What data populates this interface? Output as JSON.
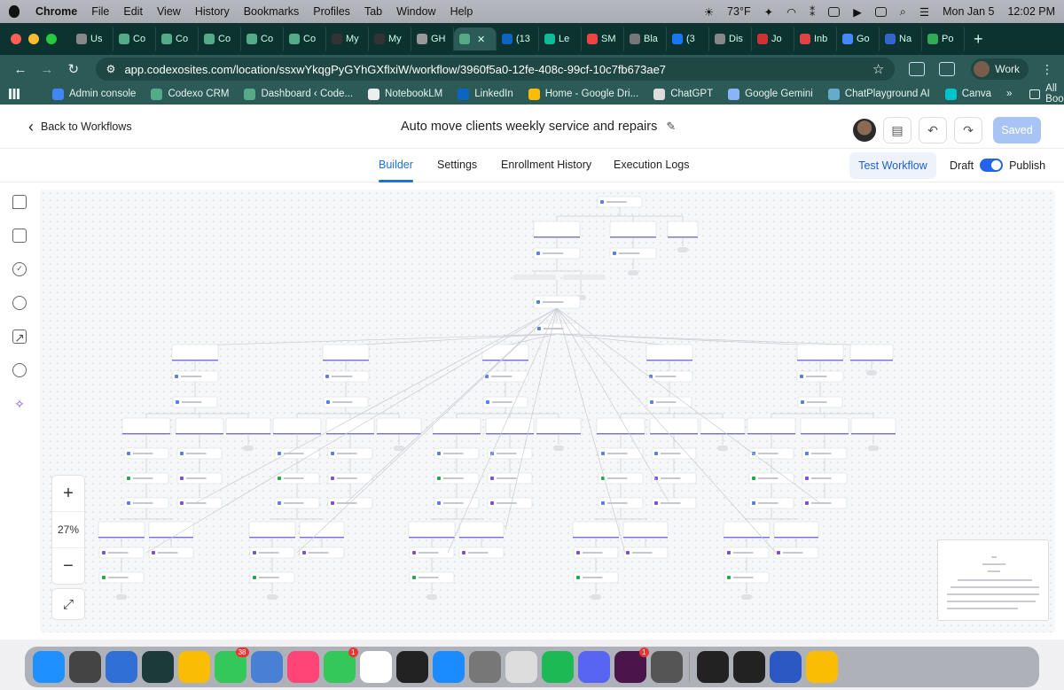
{
  "menubar": {
    "app": "Chrome",
    "items": [
      "File",
      "Edit",
      "View",
      "History",
      "Bookmarks",
      "Profiles",
      "Tab",
      "Window",
      "Help"
    ],
    "weather": "73°F",
    "date": "Mon Jan 5",
    "time": "12:02 PM"
  },
  "tabs": [
    {
      "label": "Us",
      "color": "#888"
    },
    {
      "label": "Co",
      "color": "#5a8"
    },
    {
      "label": "Co",
      "color": "#5a8"
    },
    {
      "label": "Co",
      "color": "#5a8"
    },
    {
      "label": "Co",
      "color": "#5a8"
    },
    {
      "label": "Co",
      "color": "#5a8"
    },
    {
      "label": "My",
      "color": "#333"
    },
    {
      "label": "My",
      "color": "#333"
    },
    {
      "label": "GH",
      "color": "#999"
    },
    {
      "label": "",
      "color": "#5a8",
      "active": true
    },
    {
      "label": "(13",
      "color": "#0a66c2"
    },
    {
      "label": "Le",
      "color": "#1b9"
    },
    {
      "label": "SM",
      "color": "#e44"
    },
    {
      "label": "Bla",
      "color": "#777"
    },
    {
      "label": "(3",
      "color": "#1877f2"
    },
    {
      "label": "Dis",
      "color": "#888"
    },
    {
      "label": "Jo",
      "color": "#c33"
    },
    {
      "label": "Inb",
      "color": "#d44"
    },
    {
      "label": "Go",
      "color": "#48f"
    },
    {
      "label": "Na",
      "color": "#36c"
    },
    {
      "label": "Po",
      "color": "#3a5"
    }
  ],
  "url": "app.codexosites.com/location/ssxwYkqgPyGYhGXflxiW/workflow/3960f5a0-12fe-408c-99cf-10c7fb673ae7",
  "profile": "Work",
  "bookmarks": [
    {
      "label": "Admin console",
      "color": "#4285f4"
    },
    {
      "label": "Codexo CRM",
      "color": "#5a8"
    },
    {
      "label": "Dashboard ‹ Code...",
      "color": "#5a8"
    },
    {
      "label": "NotebookLM",
      "color": "#eee"
    },
    {
      "label": "LinkedIn",
      "color": "#0a66c2"
    },
    {
      "label": "Home - Google Dri...",
      "color": "#fbbc04"
    },
    {
      "label": "ChatGPT",
      "color": "#ddd"
    },
    {
      "label": "Google Gemini",
      "color": "#8ab4f8"
    },
    {
      "label": "ChatPlayground AI",
      "color": "#6ac"
    },
    {
      "label": "Canva",
      "color": "#00c4cc"
    }
  ],
  "all_bookmarks": "All Bookmarks",
  "header": {
    "back": "Back to Workflows",
    "title": "Auto move clients weekly service and repairs",
    "saved": "Saved"
  },
  "nav": {
    "tabs": [
      "Builder",
      "Settings",
      "Enrollment History",
      "Execution Logs"
    ],
    "test": "Test Workflow",
    "draft": "Draft",
    "publish": "Publish"
  },
  "zoom": {
    "plus": "+",
    "level": "27%",
    "minus": "−"
  },
  "dock": [
    {
      "c": "#1e90ff"
    },
    {
      "c": "#444"
    },
    {
      "c": "#2f6fd6"
    },
    {
      "c": "#1c3a3a"
    },
    {
      "c": "#fbbc04"
    },
    {
      "c": "#34c759",
      "badge": "38"
    },
    {
      "c": "#4a7fd6"
    },
    {
      "c": "#f47"
    },
    {
      "c": "#34c759",
      "badge": "1"
    },
    {
      "c": "#fff"
    },
    {
      "c": "#222"
    },
    {
      "c": "#1a8cff"
    },
    {
      "c": "#777"
    },
    {
      "c": "#ddd"
    },
    {
      "c": "#1db954"
    },
    {
      "c": "#5865f2"
    },
    {
      "c": "#4a154b",
      "badge": "1"
    },
    {
      "c": "#555"
    },
    {
      "c": "#222"
    },
    {
      "c": "#222"
    },
    {
      "c": "#2b59c3"
    },
    {
      "c": "#fbbc04"
    }
  ]
}
